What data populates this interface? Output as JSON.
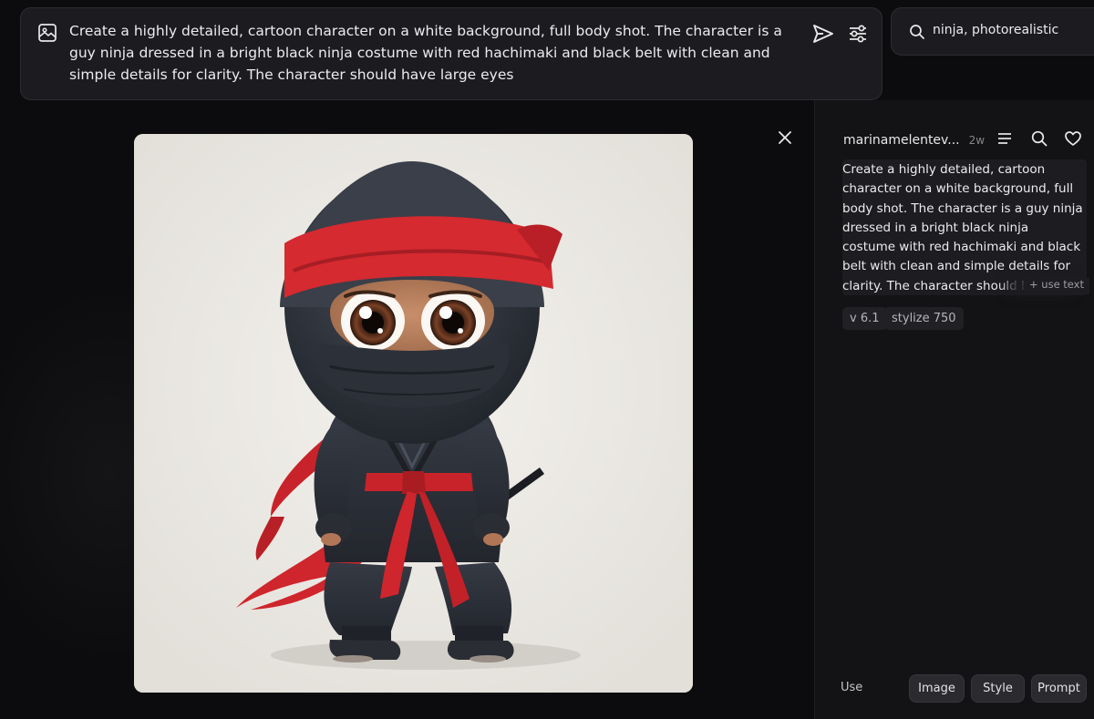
{
  "prompt_bar": {
    "text": "Create a highly detailed, cartoon character on a white background, full body shot. The character is a guy ninja dressed in a bright black ninja costume with red hachimaki and black belt with clean and simple details for clarity. The character should have large eyes",
    "icons": [
      "image-icon",
      "send-icon",
      "settings-sliders-icon"
    ]
  },
  "search": {
    "value": "ninja, photorealistic",
    "icon": "search-icon"
  },
  "viewer": {
    "close_icon": "close-icon",
    "image_subject": "ninja"
  },
  "side_panel": {
    "author": "marinamelentev...",
    "time": "2w",
    "icons": [
      "list-icon",
      "search-icon",
      "heart-icon"
    ],
    "prompt": "Create a highly detailed, cartoon character on a white background, full body shot. The character is a guy ninja dressed in a bright black ninja costume with red hachimaki and black belt with clean and simple details for clarity. The character should have large eyes",
    "use_text": "+ use text",
    "tags": [
      "v 6.1",
      "stylize 750"
    ],
    "use_label": "Use",
    "use_buttons": [
      "Image",
      "Style",
      "Prompt"
    ]
  },
  "colors": {
    "background": "#0e0e10",
    "panel": "#1c1c20",
    "ninja_red": "#d7282d",
    "ninja_suit": "#2c3038"
  }
}
